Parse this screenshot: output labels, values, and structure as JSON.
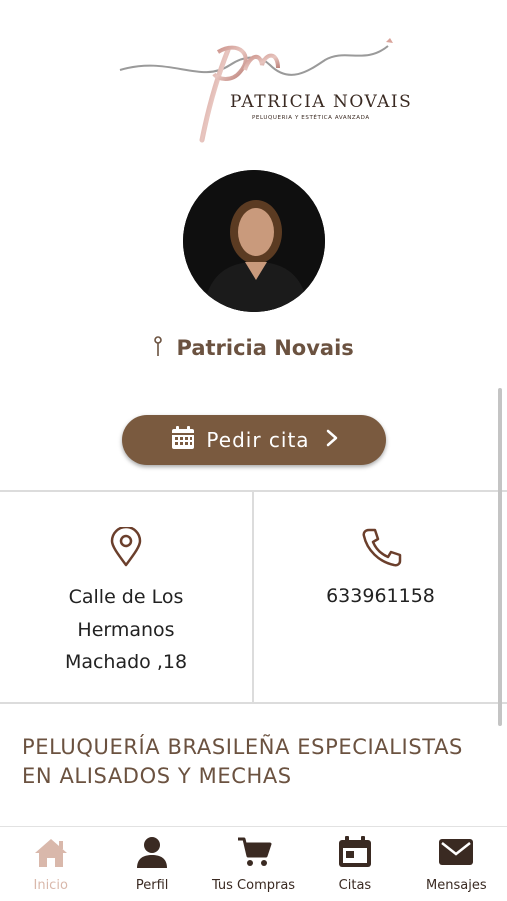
{
  "brand": {
    "monogram": "pn",
    "name": "PATRICIA NOVAIS",
    "tagline": "PELUQUERIA Y ESTÉTICA AVANZADA"
  },
  "profile": {
    "name": "Patricia Novais"
  },
  "cta": {
    "label": "Pedir cita",
    "icon": "calendar-icon",
    "chevron": "chevron-right-icon"
  },
  "contact": {
    "address_lines": [
      "Calle de Los",
      "Hermanos",
      "Machado ,18"
    ],
    "phone": "633961158",
    "address_icon": "location-pin-icon",
    "phone_icon": "phone-icon"
  },
  "description": {
    "text": "PELUQUERÍA BRASILEÑA ESPECIALISTAS EN ALISADOS Y MECHAS"
  },
  "nav": {
    "items": [
      {
        "label": "Inicio",
        "icon": "home-icon",
        "active": true
      },
      {
        "label": "Perfil",
        "icon": "user-icon",
        "active": false
      },
      {
        "label": "Tus Compras",
        "icon": "cart-icon",
        "active": false
      },
      {
        "label": "Citas",
        "icon": "calendar-icon",
        "active": false
      },
      {
        "label": "Mensajes",
        "icon": "mail-icon",
        "active": false
      }
    ]
  },
  "colors": {
    "accent_brown": "#7a5a3f",
    "text_brown": "#6b5240",
    "nav_active": "#d9b8ab",
    "nav_icon": "#3a2a22"
  }
}
